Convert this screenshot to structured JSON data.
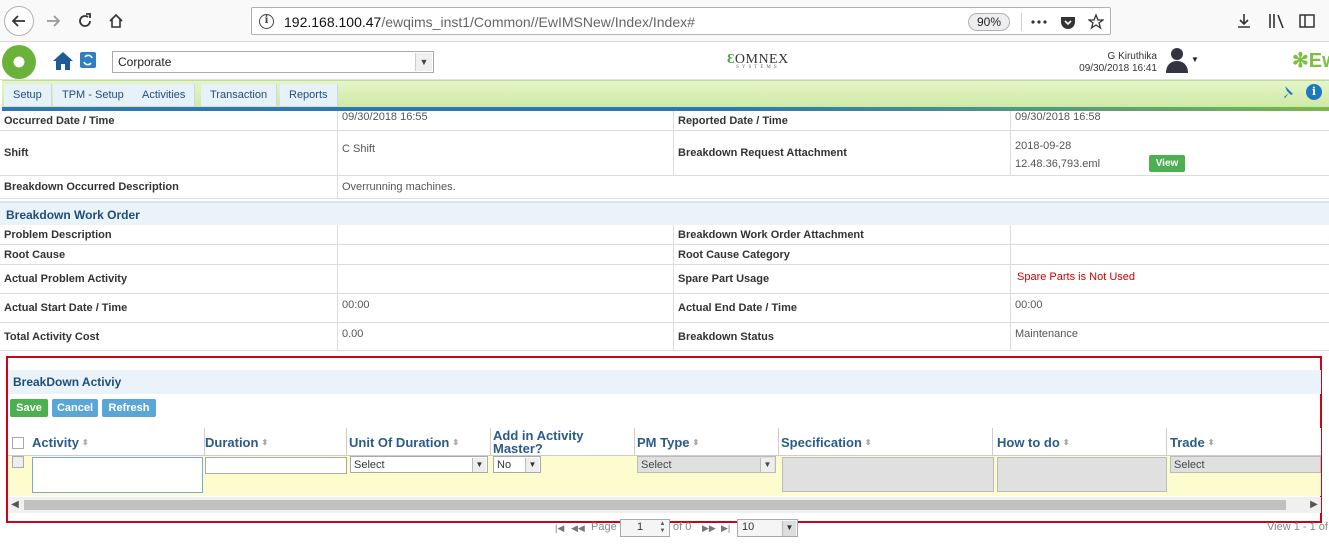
{
  "browser": {
    "url_host": "192.168.100.47",
    "url_path": "/ewqims_inst1/Common//EwIMSNew/Index/Index#",
    "zoom": "90%"
  },
  "app": {
    "company_select": "Corporate",
    "logo_text": "OMNEX",
    "logo_sub": "SYSTEMS",
    "user_name": "G Kiruthika",
    "user_datetime": "09/30/2018 16:41",
    "brand_text": "Ew"
  },
  "menu": {
    "items": [
      {
        "label": "Setup"
      },
      {
        "label": "TPM - Setup"
      },
      {
        "label": "Activities"
      },
      {
        "label": "Transaction"
      },
      {
        "label": "Reports"
      }
    ]
  },
  "details": {
    "occurred_label": "Occurred Date / Time",
    "occurred_value": "09/30/2018 16:55",
    "reported_label": "Reported Date / Time",
    "reported_value": "09/30/2018 16:58",
    "shift_label": "Shift",
    "shift_value": "C Shift",
    "attachment_label": "Breakdown Request Attachment",
    "attachment_value_1": "2018-09-28",
    "attachment_value_2": "12.48.36,793.eml",
    "view_button": "View",
    "occurred_desc_label": "Breakdown Occurred Description",
    "occurred_desc_value": "Overrunning machines."
  },
  "work_order": {
    "section_title": "Breakdown Work Order",
    "problem_label": "Problem Description",
    "problem_value": "",
    "wo_attachment_label": "Breakdown Work Order Attachment",
    "wo_attachment_value": "",
    "root_cause_label": "Root Cause",
    "root_cause_value": "",
    "root_cause_cat_label": "Root Cause Category",
    "root_cause_cat_value": "",
    "actual_problem_label": "Actual Problem Activity",
    "actual_problem_value": "",
    "spare_label": "Spare Part Usage",
    "spare_value": "Spare Parts is Not Used",
    "start_label": "Actual Start Date / Time",
    "start_value": "00:00",
    "end_label": "Actual End Date / Time",
    "end_value": "00:00",
    "cost_label": "Total Activity Cost",
    "cost_value": "0.00",
    "status_label": "Breakdown Status",
    "status_value": "Maintenance"
  },
  "activity_grid": {
    "title": "BreakDown Activiy",
    "save_button": "Save",
    "cancel_button": "Cancel",
    "refresh_button": "Refresh",
    "columns": [
      "Activity",
      "Duration",
      "Unit Of Duration",
      "Add in Activity Master?",
      "PM Type",
      "Specification",
      "How to do",
      "Trade"
    ],
    "row": {
      "unit_select": "Select",
      "master_select": "No",
      "pm_type_select": "Select",
      "trade_select": "Select"
    }
  },
  "pager": {
    "page_label": "Page",
    "page_value": "1",
    "of_label": "of 0",
    "rows_per_page": "10",
    "view_info": "View 1 - 1 of"
  }
}
